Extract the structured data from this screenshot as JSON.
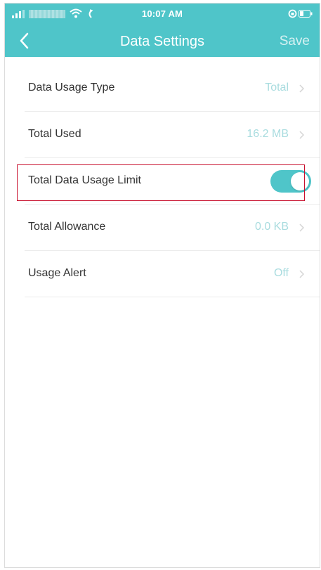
{
  "status_bar": {
    "time": "10:07 AM"
  },
  "nav": {
    "title": "Data Settings",
    "save_label": "Save"
  },
  "settings": [
    {
      "label": "Data Usage Type",
      "value": "Total"
    },
    {
      "label": "Total Used",
      "value": "16.2 MB"
    },
    {
      "label": "Total Data Usage Limit",
      "toggle_on": true
    },
    {
      "label": "Total Allowance",
      "value": "0.0 KB"
    },
    {
      "label": "Usage Alert",
      "value": "Off"
    }
  ],
  "colors": {
    "accent": "#4fc5c9",
    "value_text": "#a9dcdf",
    "highlight_border": "#c8102e"
  }
}
